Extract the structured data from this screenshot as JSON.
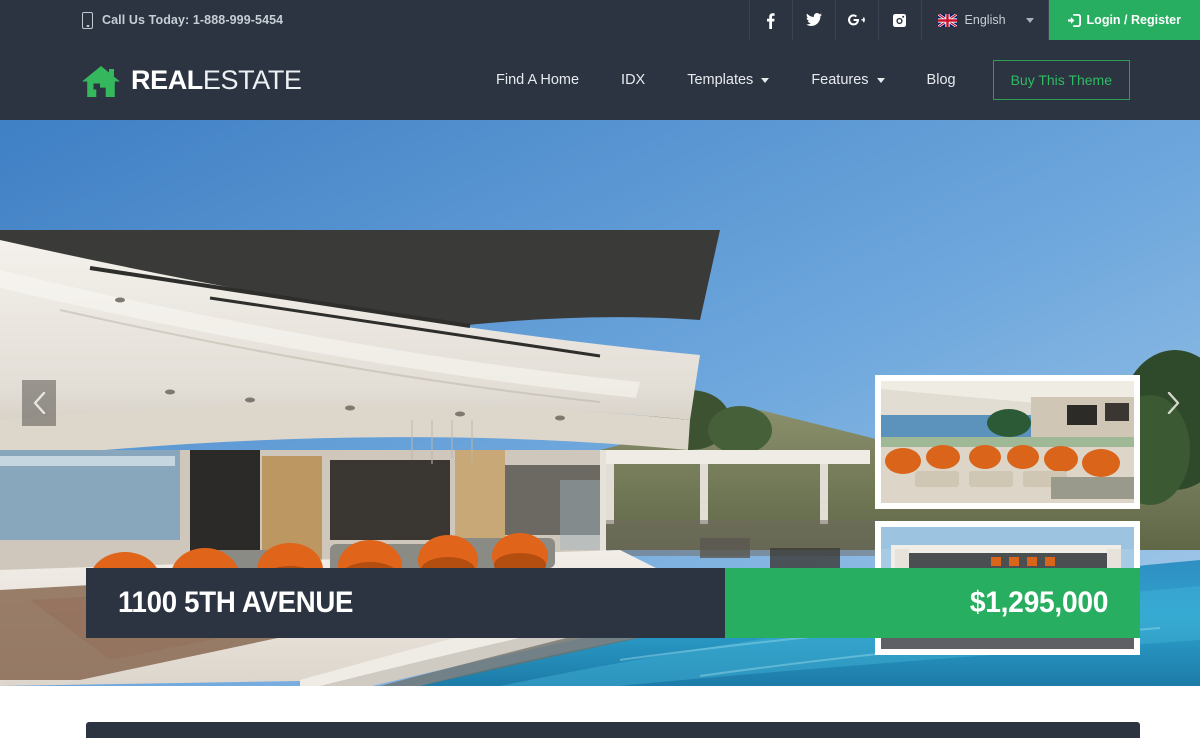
{
  "topbar": {
    "phone_icon": "mobile-phone-icon",
    "phone_text": "Call Us Today: 1-888-999-5454",
    "social": [
      {
        "name": "facebook-icon",
        "label": "f"
      },
      {
        "name": "twitter-icon",
        "label": "t"
      },
      {
        "name": "google-plus-icon",
        "label": "g+"
      },
      {
        "name": "instagram-icon",
        "label": "ig"
      }
    ],
    "language": {
      "label": "English",
      "flag": "uk-flag-icon",
      "caret": "chevron-down-icon"
    },
    "login": {
      "label": "Login / Register",
      "icon": "sign-in-icon"
    }
  },
  "header": {
    "logo": {
      "icon": "house-icon",
      "bold": "REAL",
      "light": "ESTATE"
    },
    "nav": [
      {
        "label": "Find A Home",
        "dropdown": false
      },
      {
        "label": "IDX",
        "dropdown": false
      },
      {
        "label": "Templates",
        "dropdown": true
      },
      {
        "label": "Features",
        "dropdown": true
      },
      {
        "label": "Blog",
        "dropdown": false
      }
    ],
    "cta": {
      "label": "Buy This Theme"
    }
  },
  "hero": {
    "prev_icon": "chevron-left-icon",
    "next_icon": "chevron-right-icon",
    "property": {
      "title": "1100 5TH AVENUE",
      "price": "$1,295,000"
    },
    "thumbnails": [
      {
        "name": "thumbnail-interior-lounge"
      },
      {
        "name": "thumbnail-pool-exterior"
      }
    ]
  },
  "colors": {
    "dark": "#2b3440",
    "green": "#27ae60",
    "green_text": "#2fbb63",
    "muted_text": "#c8ced6"
  }
}
